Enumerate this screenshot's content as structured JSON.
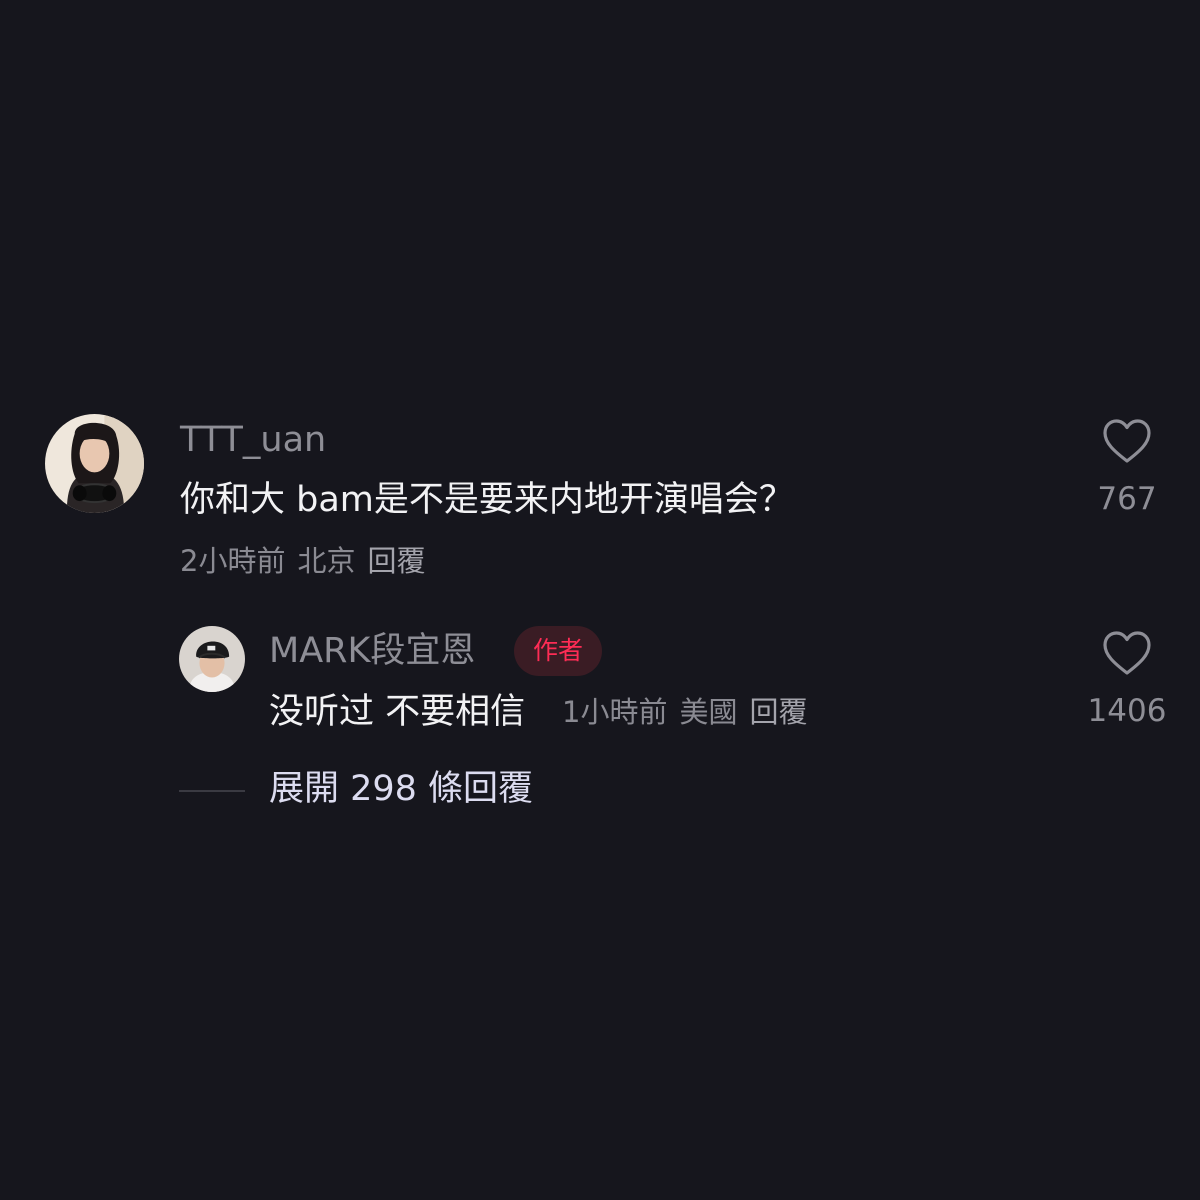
{
  "comment": {
    "username": "TTT_uan",
    "text": "你和大 bam是不是要来内地开演唱会？",
    "time": "2小時前",
    "location": "北京",
    "reply_label": "回覆",
    "like_count": "767",
    "avatar_icon": "woman-with-headphones-avatar"
  },
  "reply": {
    "username": "MARK段宜恩",
    "badge": "作者",
    "text": "没听过 不要相信",
    "time": "1小時前",
    "location": "美國",
    "reply_label": "回覆",
    "like_count": "1406",
    "avatar_icon": "man-in-beanie-avatar"
  },
  "expand_replies": "展開 298 條回覆",
  "colors": {
    "background": "#16161d",
    "badge_text": "#fe2c55",
    "badge_bg": "#3a1c24",
    "primary_text": "#f2f2f4",
    "secondary_text": "#8e8e96"
  }
}
